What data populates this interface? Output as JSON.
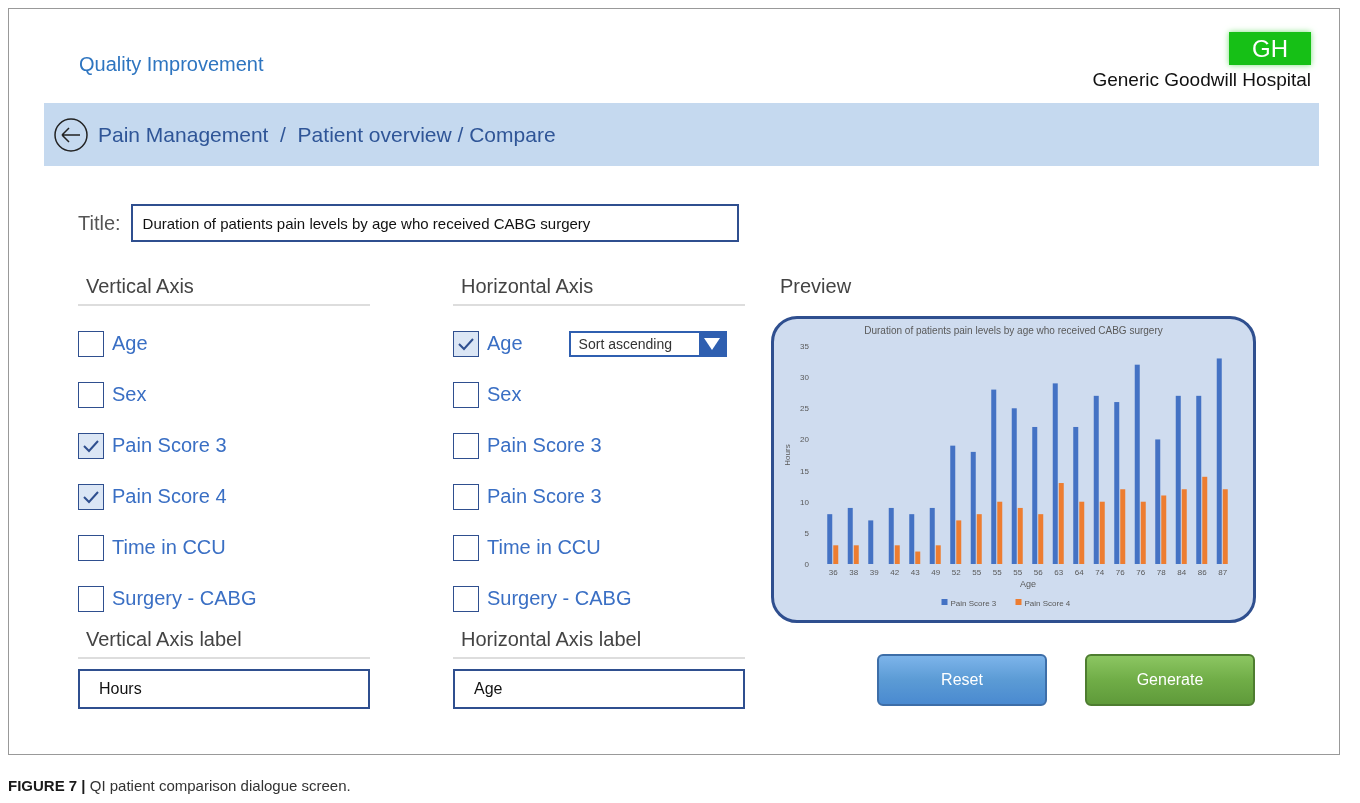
{
  "header": {
    "title": "Quality Improvement",
    "logo": "GH",
    "hospital": "Generic Goodwill Hospital"
  },
  "breadcrumb": {
    "text": "Pain Management  /  Patient overview / Compare"
  },
  "title_field": {
    "label": "Title:",
    "value": "Duration of patients pain levels by age who received CABG surgery"
  },
  "vertical_axis": {
    "heading": "Vertical Axis",
    "options": [
      {
        "label": "Age",
        "checked": false
      },
      {
        "label": "Sex",
        "checked": false
      },
      {
        "label": "Pain Score 3",
        "checked": true
      },
      {
        "label": "Pain Score 4",
        "checked": true
      },
      {
        "label": "Time in CCU",
        "checked": false
      },
      {
        "label": "Surgery - CABG",
        "checked": false
      }
    ]
  },
  "horizontal_axis": {
    "heading": "Horizontal Axis",
    "options": [
      {
        "label": "Age",
        "checked": true,
        "dropdown": "Sort ascending"
      },
      {
        "label": "Sex",
        "checked": false
      },
      {
        "label": "Pain Score 3",
        "checked": false
      },
      {
        "label": "Pain Score 3",
        "checked": false
      },
      {
        "label": "Time in CCU",
        "checked": false
      },
      {
        "label": "Surgery - CABG",
        "checked": false
      }
    ]
  },
  "vertical_axis_label": {
    "heading": "Vertical Axis label",
    "value": "Hours"
  },
  "horizontal_axis_label": {
    "heading": "Horizontal Axis label",
    "value": "Age"
  },
  "preview": {
    "heading": "Preview",
    "chart_data": {
      "type": "bar",
      "title": "Duration of patients pain levels by age who received CABG surgery",
      "xlabel": "Age",
      "ylabel": "Hours",
      "categories": [
        "36",
        "38",
        "39",
        "42",
        "43",
        "49",
        "52",
        "55",
        "55",
        "55",
        "56",
        "63",
        "64",
        "74",
        "76",
        "76",
        "78",
        "84",
        "86",
        "87"
      ],
      "series": [
        {
          "name": "Pain Score 3",
          "color": "#4472c4",
          "values": [
            8,
            9,
            7,
            9,
            8,
            9,
            19,
            18,
            28,
            25,
            22,
            29,
            22,
            27,
            26,
            32,
            20,
            27,
            27,
            33
          ]
        },
        {
          "name": "Pain Score 4",
          "color": "#ed7d31",
          "values": [
            3,
            3,
            0,
            3,
            2,
            3,
            7,
            8,
            10,
            9,
            8,
            13,
            10,
            10,
            12,
            10,
            11,
            12,
            14,
            12
          ]
        }
      ],
      "legend": true,
      "ylim": [
        0,
        35
      ],
      "yticks": [
        0,
        5,
        10,
        15,
        20,
        25,
        30,
        35
      ]
    }
  },
  "buttons": [
    {
      "label": "Reset",
      "kind": "reset"
    },
    {
      "label": "Generate",
      "kind": "generate"
    }
  ],
  "caption": {
    "label": "FIGURE 7 |",
    "text": "QI patient comparison dialogue screen."
  }
}
